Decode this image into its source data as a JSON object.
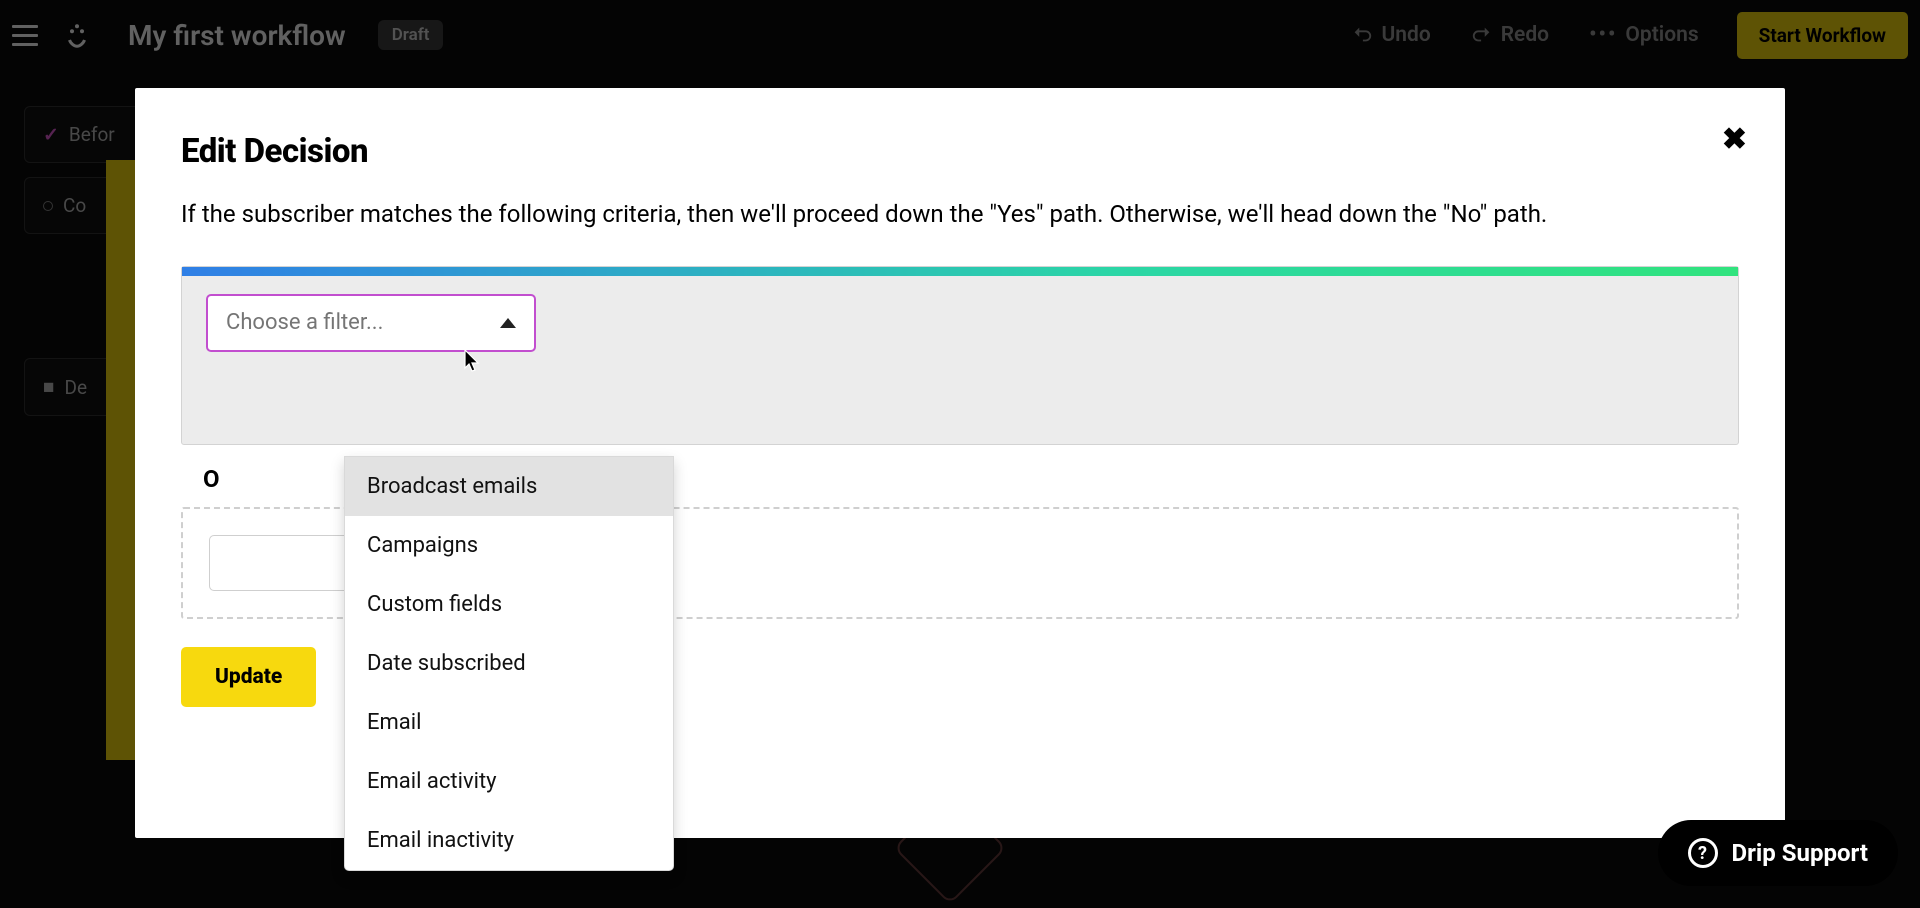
{
  "topbar": {
    "title": "My first workflow",
    "draft_label": "Draft",
    "undo_label": "Undo",
    "redo_label": "Redo",
    "options_label": "Options",
    "start_label": "Start Workflow"
  },
  "background": {
    "before_label": "Befor",
    "co_label": "Co",
    "de_label": "De"
  },
  "modal": {
    "title": "Edit Decision",
    "description": "If the subscriber matches the following criteria, then we'll proceed down the \"Yes\" path. Otherwise, we'll head down the \"No\" path.",
    "filter_placeholder": "Choose a filter...",
    "or_label": "O",
    "or_select_trail": ".",
    "update_label": "Update",
    "options": [
      "Broadcast emails",
      "Campaigns",
      "Custom fields",
      "Date subscribed",
      "Email",
      "Email activity",
      "Email inactivity"
    ]
  },
  "support": {
    "label": "Drip Support"
  }
}
